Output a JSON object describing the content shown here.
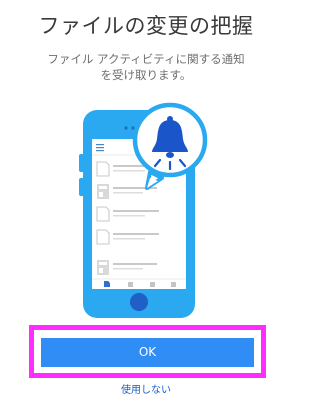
{
  "screen": {
    "title": "ファイルの変更の把握",
    "description_line1": "ファイル アクティビティに関する通知",
    "description_line2": "を受け取ります。"
  },
  "illustration": {
    "phone_icon": "smartphone-icon",
    "bell_icon": "bell-icon",
    "colors": {
      "phone_body": "#2aa8f0",
      "bubble_border": "#2aa8f0",
      "bell": "#1a56c9"
    }
  },
  "actions": {
    "ok_label": "OK",
    "dont_use_label": "使用しない"
  },
  "colors": {
    "accent": "#2f8df5",
    "highlight_frame": "#ff2dff",
    "link": "#1a5fcf"
  }
}
